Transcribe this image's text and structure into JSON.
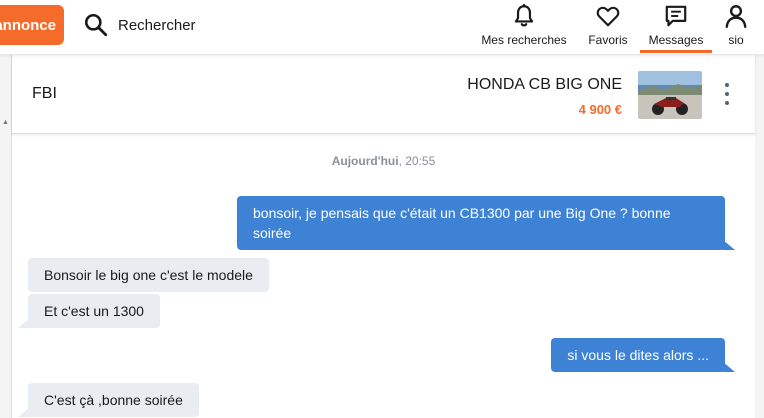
{
  "header": {
    "post_ad_label": "annonce",
    "search_label": "Rechercher",
    "nav": [
      {
        "label": "Mes recherches",
        "icon": "bell-icon"
      },
      {
        "label": "Favoris",
        "icon": "heart-icon"
      },
      {
        "label": "Messages",
        "icon": "message-icon",
        "active": true
      },
      {
        "label": "sio",
        "icon": "user-icon"
      }
    ],
    "accent_color": "#f56b2a"
  },
  "conversation": {
    "contact_name": "FBI",
    "ad_title": "HONDA CB BIG ONE",
    "ad_price": "4 900 €",
    "day_label": "Aujourd'hui",
    "day_time": ", 20:55"
  },
  "messages": [
    {
      "from": "me",
      "text": "bonsoir, je pensais que c'était un CB1300 par une Big One ? bonne soirée"
    },
    {
      "from": "them",
      "text": "Bonsoir le big one c'est le modele"
    },
    {
      "from": "them",
      "text": "Et c'est un 1300"
    },
    {
      "from": "me",
      "text": "si vous le dites alors ..."
    },
    {
      "from": "them",
      "text": "C'est çà ,bonne soirée"
    }
  ],
  "colors": {
    "sent_bubble": "#3e82d6",
    "received_bubble": "#e9ecf0"
  }
}
